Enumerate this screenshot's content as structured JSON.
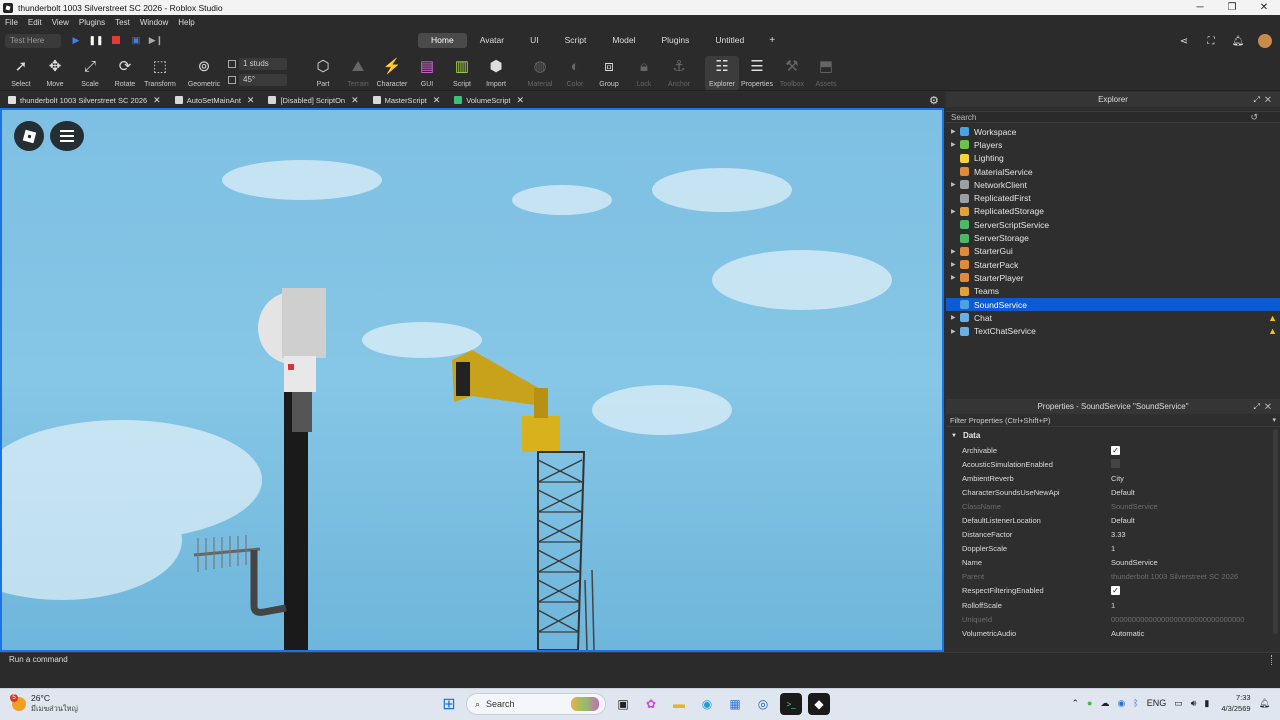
{
  "window": {
    "title": "thunderbolt 1003 Silverstreet SC 2026 - Roblox Studio"
  },
  "menu": [
    "File",
    "Edit",
    "View",
    "Plugins",
    "Test",
    "Window",
    "Help"
  ],
  "test_dropdown": "Test Here",
  "ribbon_tabs": [
    "Home",
    "Avatar",
    "UI",
    "Script",
    "Model",
    "Plugins",
    "Untitled"
  ],
  "active_tab": "Home",
  "toolbar": {
    "select": "Select",
    "move": "Move",
    "scale": "Scale",
    "rotate": "Rotate",
    "transform": "Transform",
    "geometric": "Geometric",
    "studs": "1 studs",
    "degrees": "45°",
    "part": "Part",
    "terrain": "Terrain",
    "character": "Character",
    "gui": "GUI",
    "script": "Script",
    "import": "Import",
    "material": "Material",
    "color": "Color",
    "group": "Group",
    "lock": "Lock",
    "anchor": "Anchor",
    "explorer": "Explorer",
    "properties": "Properties",
    "toolbox": "Toolbox",
    "assets": "Assets"
  },
  "doc_tabs": [
    {
      "label": "thunderbolt 1003 Silverstreet SC 2026",
      "icon": "place-icon"
    },
    {
      "label": "AutoSetMainAnt",
      "icon": "script-icon"
    },
    {
      "label": "[Disabled] ScriptOn",
      "icon": "script-icon"
    },
    {
      "label": "MasterScript",
      "icon": "script-icon"
    },
    {
      "label": "VolumeScript",
      "icon": "localscript-icon"
    }
  ],
  "explorer": {
    "title": "Explorer",
    "search_placeholder": "Search",
    "items": [
      {
        "label": "Workspace",
        "expand": true,
        "color": "#4aa3e0",
        "selected": false,
        "warn": false
      },
      {
        "label": "Players",
        "expand": true,
        "color": "#6cc24a",
        "selected": false,
        "warn": false
      },
      {
        "label": "Lighting",
        "expand": false,
        "color": "#f2d33b",
        "selected": false,
        "warn": false
      },
      {
        "label": "MaterialService",
        "expand": false,
        "color": "#e08a3a",
        "selected": false,
        "warn": false
      },
      {
        "label": "NetworkClient",
        "expand": true,
        "color": "#9aa0a6",
        "selected": false,
        "warn": false
      },
      {
        "label": "ReplicatedFirst",
        "expand": false,
        "color": "#9aa0a6",
        "selected": false,
        "warn": false
      },
      {
        "label": "ReplicatedStorage",
        "expand": true,
        "color": "#e0a03a",
        "selected": false,
        "warn": false
      },
      {
        "label": "ServerScriptService",
        "expand": false,
        "color": "#4cb86a",
        "selected": false,
        "warn": false
      },
      {
        "label": "ServerStorage",
        "expand": false,
        "color": "#4cb86a",
        "selected": false,
        "warn": false
      },
      {
        "label": "StarterGui",
        "expand": true,
        "color": "#e08a3a",
        "selected": false,
        "warn": false
      },
      {
        "label": "StarterPack",
        "expand": true,
        "color": "#e08a3a",
        "selected": false,
        "warn": false
      },
      {
        "label": "StarterPlayer",
        "expand": true,
        "color": "#e08a3a",
        "selected": false,
        "warn": false
      },
      {
        "label": "Teams",
        "expand": false,
        "color": "#e0a03a",
        "selected": false,
        "warn": false
      },
      {
        "label": "SoundService",
        "expand": false,
        "color": "#4aa3e0",
        "selected": true,
        "warn": false
      },
      {
        "label": "Chat",
        "expand": true,
        "color": "#6ab0e6",
        "selected": false,
        "warn": true
      },
      {
        "label": "TextChatService",
        "expand": true,
        "color": "#6ab0e6",
        "selected": false,
        "warn": true
      }
    ]
  },
  "properties": {
    "title": "Properties - SoundService \"SoundService\"",
    "filter": "Filter Properties (Ctrl+Shift+P)",
    "section": "Data",
    "rows": [
      {
        "k": "Archivable",
        "v": "",
        "check": true,
        "ro": false
      },
      {
        "k": "AcousticSimulationEnabled",
        "v": "",
        "check": false,
        "ro": false
      },
      {
        "k": "AmbientReverb",
        "v": "City",
        "ro": false
      },
      {
        "k": "CharacterSoundsUseNewApi",
        "v": "Default",
        "ro": false
      },
      {
        "k": "ClassName",
        "v": "SoundService",
        "ro": true
      },
      {
        "k": "DefaultListenerLocation",
        "v": "Default",
        "ro": false
      },
      {
        "k": "DistanceFactor",
        "v": "3.33",
        "ro": false
      },
      {
        "k": "DopplerScale",
        "v": "1",
        "ro": false
      },
      {
        "k": "Name",
        "v": "SoundService",
        "ro": false
      },
      {
        "k": "Parent",
        "v": "thunderbolt 1003 Silverstreet SC 2026",
        "ro": true
      },
      {
        "k": "RespectFilteringEnabled",
        "v": "",
        "check": true,
        "ro": false
      },
      {
        "k": "RolloffScale",
        "v": "1",
        "ro": false
      },
      {
        "k": "UniqueId",
        "v": "00000000000000000000000000000000",
        "ro": true
      },
      {
        "k": "VolumetricAudio",
        "v": "Automatic",
        "ro": false
      }
    ]
  },
  "command_bar": {
    "placeholder": "Run a command"
  },
  "taskbar": {
    "temp": "26°C",
    "weather": "มีเมฆส่วนใหญ่",
    "weather_badge": "5",
    "search": "Search",
    "lang": "ENG",
    "time": "7:33",
    "date": "4/3/2569"
  }
}
